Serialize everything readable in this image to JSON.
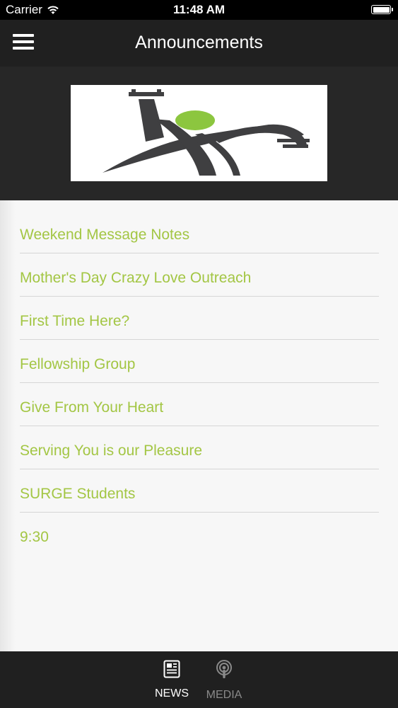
{
  "status_bar": {
    "carrier": "Carrier",
    "time": "11:48 AM"
  },
  "nav": {
    "title": "Announcements"
  },
  "announcements": [
    "Weekend Message Notes",
    "Mother's Day Crazy Love Outreach",
    "First Time Here?",
    "Fellowship Group",
    "Give From Your Heart",
    "Serving You is our Pleasure",
    "SURGE Students",
    "9:30"
  ],
  "tabs": [
    {
      "label": "NEWS",
      "icon": "newspaper-icon",
      "active": true
    },
    {
      "label": "MEDIA",
      "icon": "podcast-icon",
      "active": false
    }
  ],
  "colors": {
    "accent": "#a3c644",
    "bar": "#202020",
    "banner": "#272727",
    "inactive_tab": "#8a8a8a"
  }
}
